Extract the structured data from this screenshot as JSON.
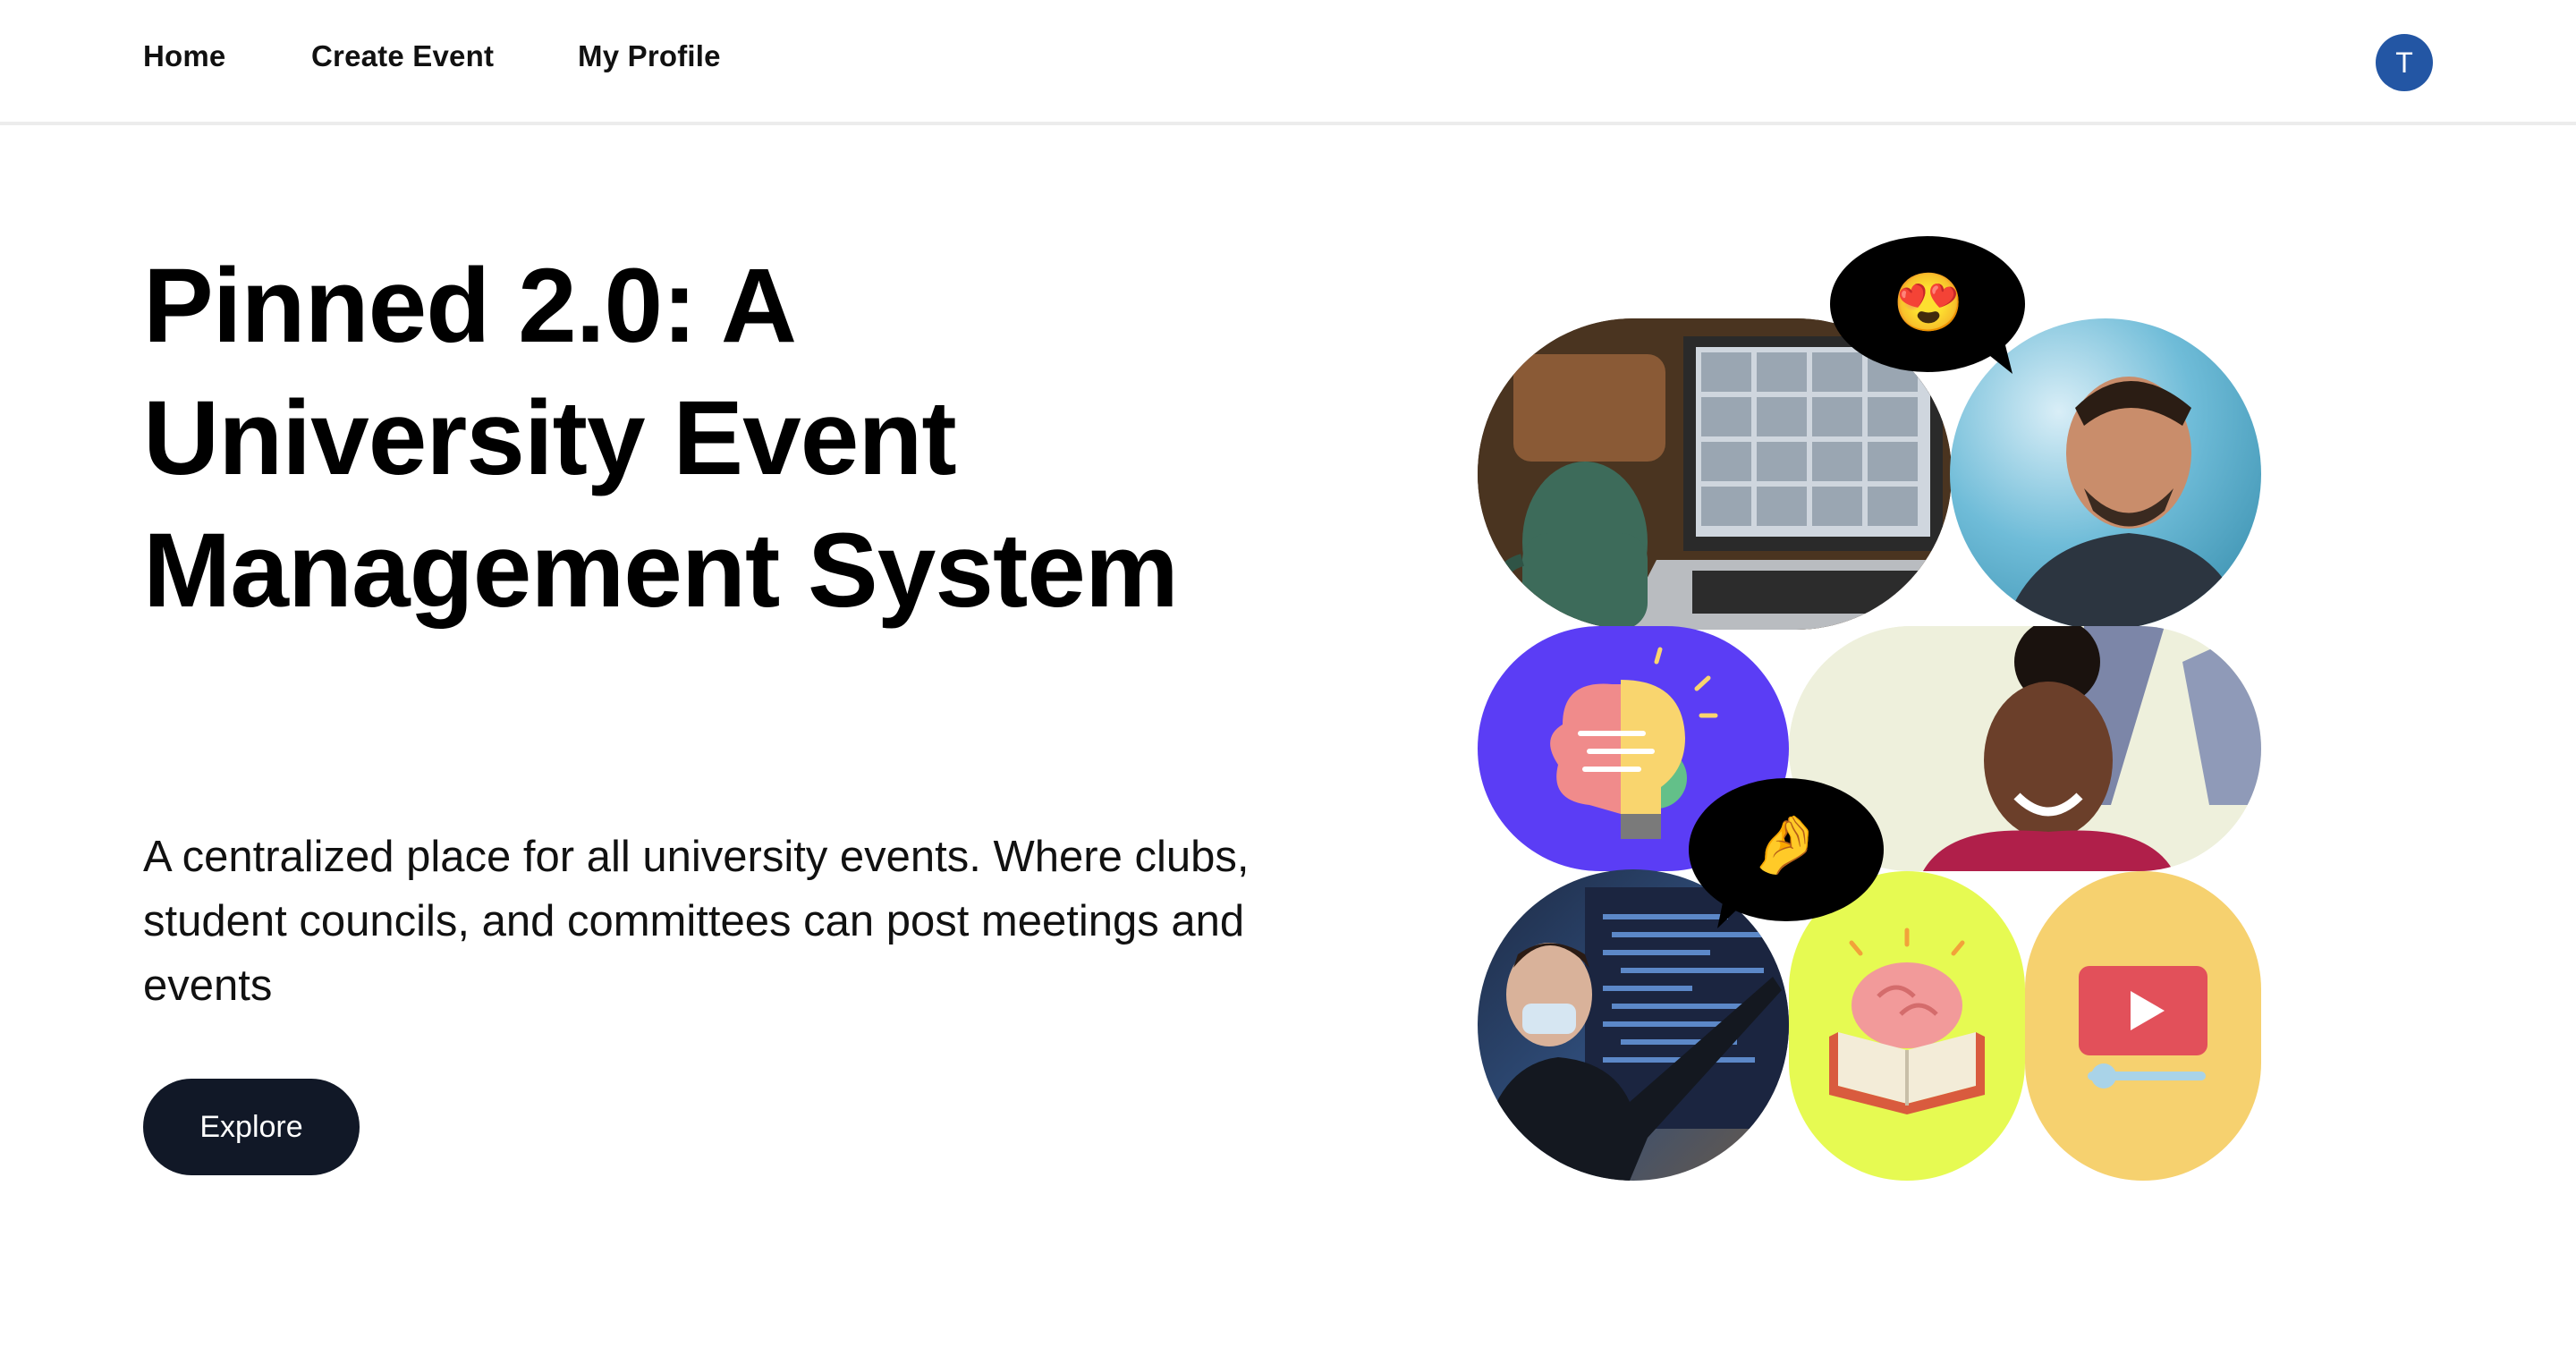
{
  "nav": {
    "home": "Home",
    "create_event": "Create Event",
    "my_profile": "My Profile",
    "avatar_initial": "T"
  },
  "hero": {
    "title": "Pinned 2.0: A University Event Management System",
    "subtitle": "A centralized place for all university events. Where clubs, student councils, and committees can post meetings and events",
    "explore_label": "Explore"
  },
  "collage": {
    "bubble_top_emoji": "😍",
    "bubble_mid_emoji": "🤌",
    "tiles": [
      "laptop-video-call-photo",
      "laughing-man-photo",
      "brain-lightbulb-icon",
      "smiling-woman-photo",
      "teacher-presenting-photo",
      "brain-book-icon",
      "video-player-icon"
    ]
  },
  "colors": {
    "accent_button": "#111827",
    "avatar": "#2356a4",
    "brain_tile": "#5b3df5",
    "book_tile": "#e6fa52",
    "video_tile": "#f6d16f"
  }
}
